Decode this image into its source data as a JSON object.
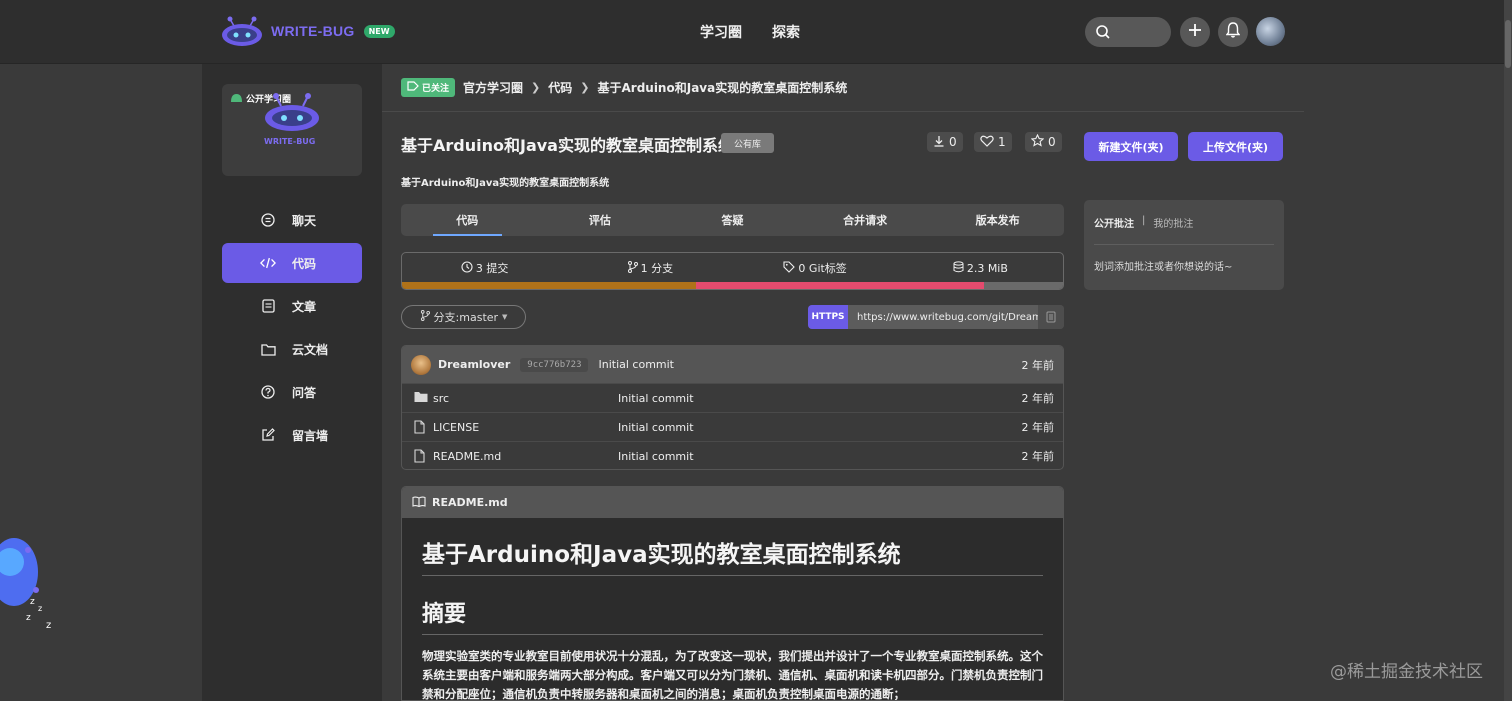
{
  "header": {
    "brand": "WRITE-BUG",
    "new_badge": "NEW",
    "nav": [
      "学习圈",
      "探索"
    ]
  },
  "sidebar": {
    "group_badge": "公开学习圈",
    "group_logo_text": "WRITE-BUG",
    "items": [
      {
        "label": "聊天",
        "icon": "chat-icon"
      },
      {
        "label": "代码",
        "icon": "code-icon",
        "active": true
      },
      {
        "label": "文章",
        "icon": "article-icon"
      },
      {
        "label": "云文档",
        "icon": "folder-icon"
      },
      {
        "label": "问答",
        "icon": "question-icon"
      },
      {
        "label": "留言墙",
        "icon": "edit-icon"
      }
    ]
  },
  "breadcrumb": {
    "follow_label": "已关注",
    "items": [
      "官方学习圈",
      "代码",
      "基于Arduino和Java实现的教室桌面控制系统"
    ]
  },
  "repo": {
    "title": "基于Arduino和Java实现的教室桌面控制系统",
    "visibility": "公有库",
    "description": "基于Arduino和Java实现的教室桌面控制系统",
    "downloads": "0",
    "likes": "1",
    "stars": "0"
  },
  "actions": {
    "new_file": "新建文件(夹)",
    "upload_file": "上传文件(夹)"
  },
  "tabs": [
    "代码",
    "评估",
    "答疑",
    "合并请求",
    "版本发布"
  ],
  "stats": {
    "commits": "3 提交",
    "branches": "1 分支",
    "tags": "0 Git标签",
    "size": "2.3 MiB"
  },
  "language_bar": [
    {
      "percent": 44.5,
      "color": "#b07219"
    },
    {
      "percent": 43.5,
      "color": "#e44b6e"
    },
    {
      "percent": 12,
      "color": "#6a6a6a"
    }
  ],
  "branch": {
    "label": "分支:master"
  },
  "clone": {
    "protocol": "HTTPS",
    "url": "https://www.writebug.com/git/Dream"
  },
  "last_commit": {
    "user": "Dreamlover",
    "hash": "9cc776b723",
    "message": "Initial commit",
    "time": "2 年前"
  },
  "files": [
    {
      "name": "src",
      "type": "folder",
      "message": "Initial commit",
      "time": "2 年前"
    },
    {
      "name": "LICENSE",
      "type": "file",
      "message": "Initial commit",
      "time": "2 年前"
    },
    {
      "name": "README.md",
      "type": "file",
      "message": "Initial commit",
      "time": "2 年前"
    }
  ],
  "readme": {
    "filename": "README.md",
    "h1": "基于Arduino和Java实现的教室桌面控制系统",
    "h2": "摘要",
    "paragraph": "物理实验室类的专业教室目前使用状况十分混乱，为了改变这一现状，我们提出并设计了一个专业教室桌面控制系统。这个系统主要由客户端和服务端两大部分构成。客户端又可以分为门禁机、通信机、桌面机和读卡机四部分。门禁机负责控制门禁和分配座位；通信机负责中转服务器和桌面机之间的消息；桌面机负责控制桌面电源的通断；"
  },
  "annotations": {
    "tab_public": "公开批注",
    "separator": "|",
    "tab_mine": "我的批注",
    "hint": "划词添加批注或者你想说的话~"
  },
  "watermark": "@稀土掘金技术社区"
}
